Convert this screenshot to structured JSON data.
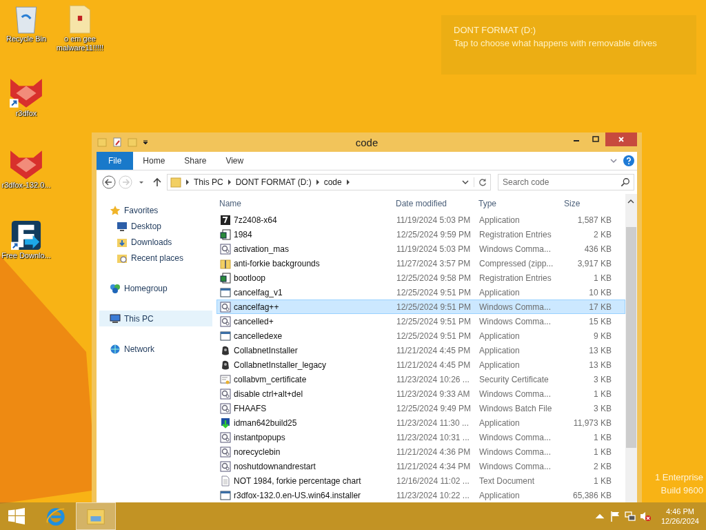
{
  "desktop_icons": [
    {
      "label": "Recycle Bin",
      "kind": "bin"
    },
    {
      "label": "o em gee malware11!!!!!",
      "kind": "folder"
    },
    {
      "label": "r3dfox",
      "kind": "fox",
      "shortcut": true
    },
    {
      "label": "r3dfox-132.0...",
      "kind": "fox",
      "shortcut": false
    },
    {
      "label": "Free Downlo...",
      "kind": "fdm",
      "shortcut": true
    }
  ],
  "notification": {
    "title": "DONT FORMAT (D:)",
    "message": "Tap to choose what happens with removable drives"
  },
  "watermark": {
    "line_1": "1 Enterprise",
    "line_2": "Build 9600"
  },
  "window": {
    "title": "code"
  },
  "ribbon_tabs": [
    {
      "label": "File",
      "selected": true
    },
    {
      "label": "Home",
      "selected": false
    },
    {
      "label": "Share",
      "selected": false
    },
    {
      "label": "View",
      "selected": false
    }
  ],
  "address_bar": {
    "crumbs": [
      "This PC",
      "DONT FORMAT (D:)",
      "code"
    ]
  },
  "search": {
    "placeholder": "Search code"
  },
  "navigation": [
    {
      "label": "Favorites",
      "kind": "star",
      "selected": false,
      "children": [
        {
          "label": "Desktop",
          "kind": "desktop",
          "selected": false
        },
        {
          "label": "Downloads",
          "kind": "downloads",
          "selected": false
        },
        {
          "label": "Recent places",
          "kind": "recent",
          "selected": false
        }
      ]
    },
    {
      "label": "Homegroup",
      "kind": "homegroup",
      "selected": false
    },
    {
      "label": "This PC",
      "kind": "pc",
      "selected": true
    },
    {
      "label": "Network",
      "kind": "network",
      "selected": false
    }
  ],
  "columns": [
    "Name",
    "Date modified",
    "Type",
    "Size"
  ],
  "files": [
    {
      "name": "7z2408-x64",
      "date": "11/19/2024 5:03 PM",
      "type": "Application",
      "size": "1,587 KB",
      "kind": "sevenzip",
      "selected": false
    },
    {
      "name": "1984",
      "date": "12/25/2024 9:59 PM",
      "type": "Registration Entries",
      "size": "2 KB",
      "kind": "reg",
      "selected": false
    },
    {
      "name": "activation_mas",
      "date": "11/19/2024 5:03 PM",
      "type": "Windows Comma...",
      "size": "436 KB",
      "kind": "cmd",
      "selected": false
    },
    {
      "name": "anti-forkie backgrounds",
      "date": "11/27/2024 3:57 PM",
      "type": "Compressed (zipp...",
      "size": "3,917 KB",
      "kind": "zip",
      "selected": false
    },
    {
      "name": "bootloop",
      "date": "12/25/2024 9:58 PM",
      "type": "Registration Entries",
      "size": "1 KB",
      "kind": "reg",
      "selected": false
    },
    {
      "name": "cancelfag_v1",
      "date": "12/25/2024 9:51 PM",
      "type": "Application",
      "size": "10 KB",
      "kind": "app",
      "selected": false
    },
    {
      "name": "cancelfag++",
      "date": "12/25/2024 9:51 PM",
      "type": "Windows Comma...",
      "size": "17 KB",
      "kind": "cmd",
      "selected": true
    },
    {
      "name": "cancelled+",
      "date": "12/25/2024 9:51 PM",
      "type": "Windows Comma...",
      "size": "15 KB",
      "kind": "cmd",
      "selected": false
    },
    {
      "name": "cancelledexe",
      "date": "12/25/2024 9:51 PM",
      "type": "Application",
      "size": "9 KB",
      "kind": "app",
      "selected": false
    },
    {
      "name": "CollabnetInstaller",
      "date": "11/21/2024 4:45 PM",
      "type": "Application",
      "size": "13 KB",
      "kind": "installer",
      "selected": false
    },
    {
      "name": "CollabnetInstaller_legacy",
      "date": "11/21/2024 4:45 PM",
      "type": "Application",
      "size": "13 KB",
      "kind": "installer",
      "selected": false
    },
    {
      "name": "collabvm_certificate",
      "date": "11/23/2024 10:26 ...",
      "type": "Security Certificate",
      "size": "3 KB",
      "kind": "cert",
      "selected": false
    },
    {
      "name": "disable ctrl+alt+del",
      "date": "11/23/2024 9:33 AM",
      "type": "Windows Comma...",
      "size": "1 KB",
      "kind": "cmd",
      "selected": false
    },
    {
      "name": "FHAAFS",
      "date": "12/25/2024 9:49 PM",
      "type": "Windows Batch File",
      "size": "3 KB",
      "kind": "cmd",
      "selected": false
    },
    {
      "name": "idman642build25",
      "date": "11/23/2024 11:30 ...",
      "type": "Application",
      "size": "11,973 KB",
      "kind": "idm",
      "selected": false
    },
    {
      "name": "instantpopups",
      "date": "11/23/2024 10:31 ...",
      "type": "Windows Comma...",
      "size": "1 KB",
      "kind": "cmd",
      "selected": false
    },
    {
      "name": "norecyclebin",
      "date": "11/21/2024 4:36 PM",
      "type": "Windows Comma...",
      "size": "1 KB",
      "kind": "cmd",
      "selected": false
    },
    {
      "name": "noshutdownandrestart",
      "date": "11/21/2024 4:34 PM",
      "type": "Windows Comma...",
      "size": "2 KB",
      "kind": "cmd",
      "selected": false
    },
    {
      "name": "NOT 1984, forkie percentage chart",
      "date": "12/16/2024 11:02 ...",
      "type": "Text Document",
      "size": "1 KB",
      "kind": "text",
      "selected": false
    },
    {
      "name": "r3dfox-132.0.en-US.win64.installer",
      "date": "11/23/2024 10:22 ...",
      "type": "Application",
      "size": "65,386 KB",
      "kind": "app",
      "selected": false
    }
  ],
  "taskbar": {
    "apps": [
      {
        "kind": "ie",
        "selected": false
      },
      {
        "kind": "explorer",
        "selected": true
      }
    ],
    "time": "4:46 PM",
    "date": "12/26/2024"
  }
}
